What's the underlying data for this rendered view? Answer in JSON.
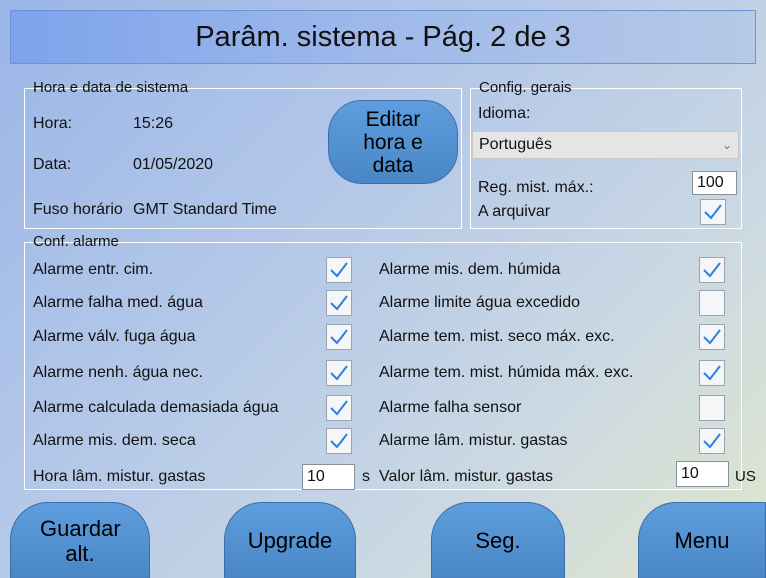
{
  "header": {
    "title": "Parâm. sistema - Pág. 2 de 3"
  },
  "system_time": {
    "legend": "Hora e data de sistema",
    "time_label": "Hora:",
    "time_value": "15:26",
    "date_label": "Data:",
    "date_value": "01/05/2020",
    "tz_label": "Fuso horário",
    "tz_value": "GMT Standard Time",
    "edit_button": "Editar hora e data"
  },
  "general": {
    "legend": "Config. gerais",
    "language_label": "Idioma:",
    "language_value": "Português",
    "max_mix_label": "Reg. mist. máx.:",
    "max_mix_value": "100",
    "archive_label": "A arquivar",
    "archive_checked": true
  },
  "alarms": {
    "legend": "Conf. alarme",
    "left": [
      {
        "label": "Alarme entr. cim.",
        "checked": true
      },
      {
        "label": "Alarme falha med. água",
        "checked": true
      },
      {
        "label": "Alarme válv. fuga água",
        "checked": true
      },
      {
        "label": "Alarme nenh. água nec.",
        "checked": true
      },
      {
        "label": "Alarme calculada demasiada água",
        "checked": true
      },
      {
        "label": "Alarme mis. dem. seca",
        "checked": true
      }
    ],
    "right": [
      {
        "label": "Alarme mis. dem. húmida",
        "checked": true
      },
      {
        "label": "Alarme limite água excedido",
        "checked": false
      },
      {
        "label": "Alarme tem. mist. seco máx. exc.",
        "checked": true
      },
      {
        "label": "Alarme tem. mist. húmida máx. exc.",
        "checked": true
      },
      {
        "label": "Alarme falha sensor",
        "checked": false
      },
      {
        "label": "Alarme lâm. mistur. gastas",
        "checked": true
      }
    ],
    "blade_hours_label": "Hora lâm. mistur. gastas",
    "blade_hours_value": "10",
    "blade_hours_unit": "s",
    "blade_value_label": "Valor lâm. mistur. gastas",
    "blade_value_value": "10",
    "blade_value_unit": "US"
  },
  "footer": {
    "save_label": "Guardar alt.",
    "upgrade_label": "Upgrade",
    "next_label": "Seg.",
    "menu_label": "Menu"
  },
  "colors": {
    "check": "#2f7fe0",
    "button": "#5a98d8"
  }
}
